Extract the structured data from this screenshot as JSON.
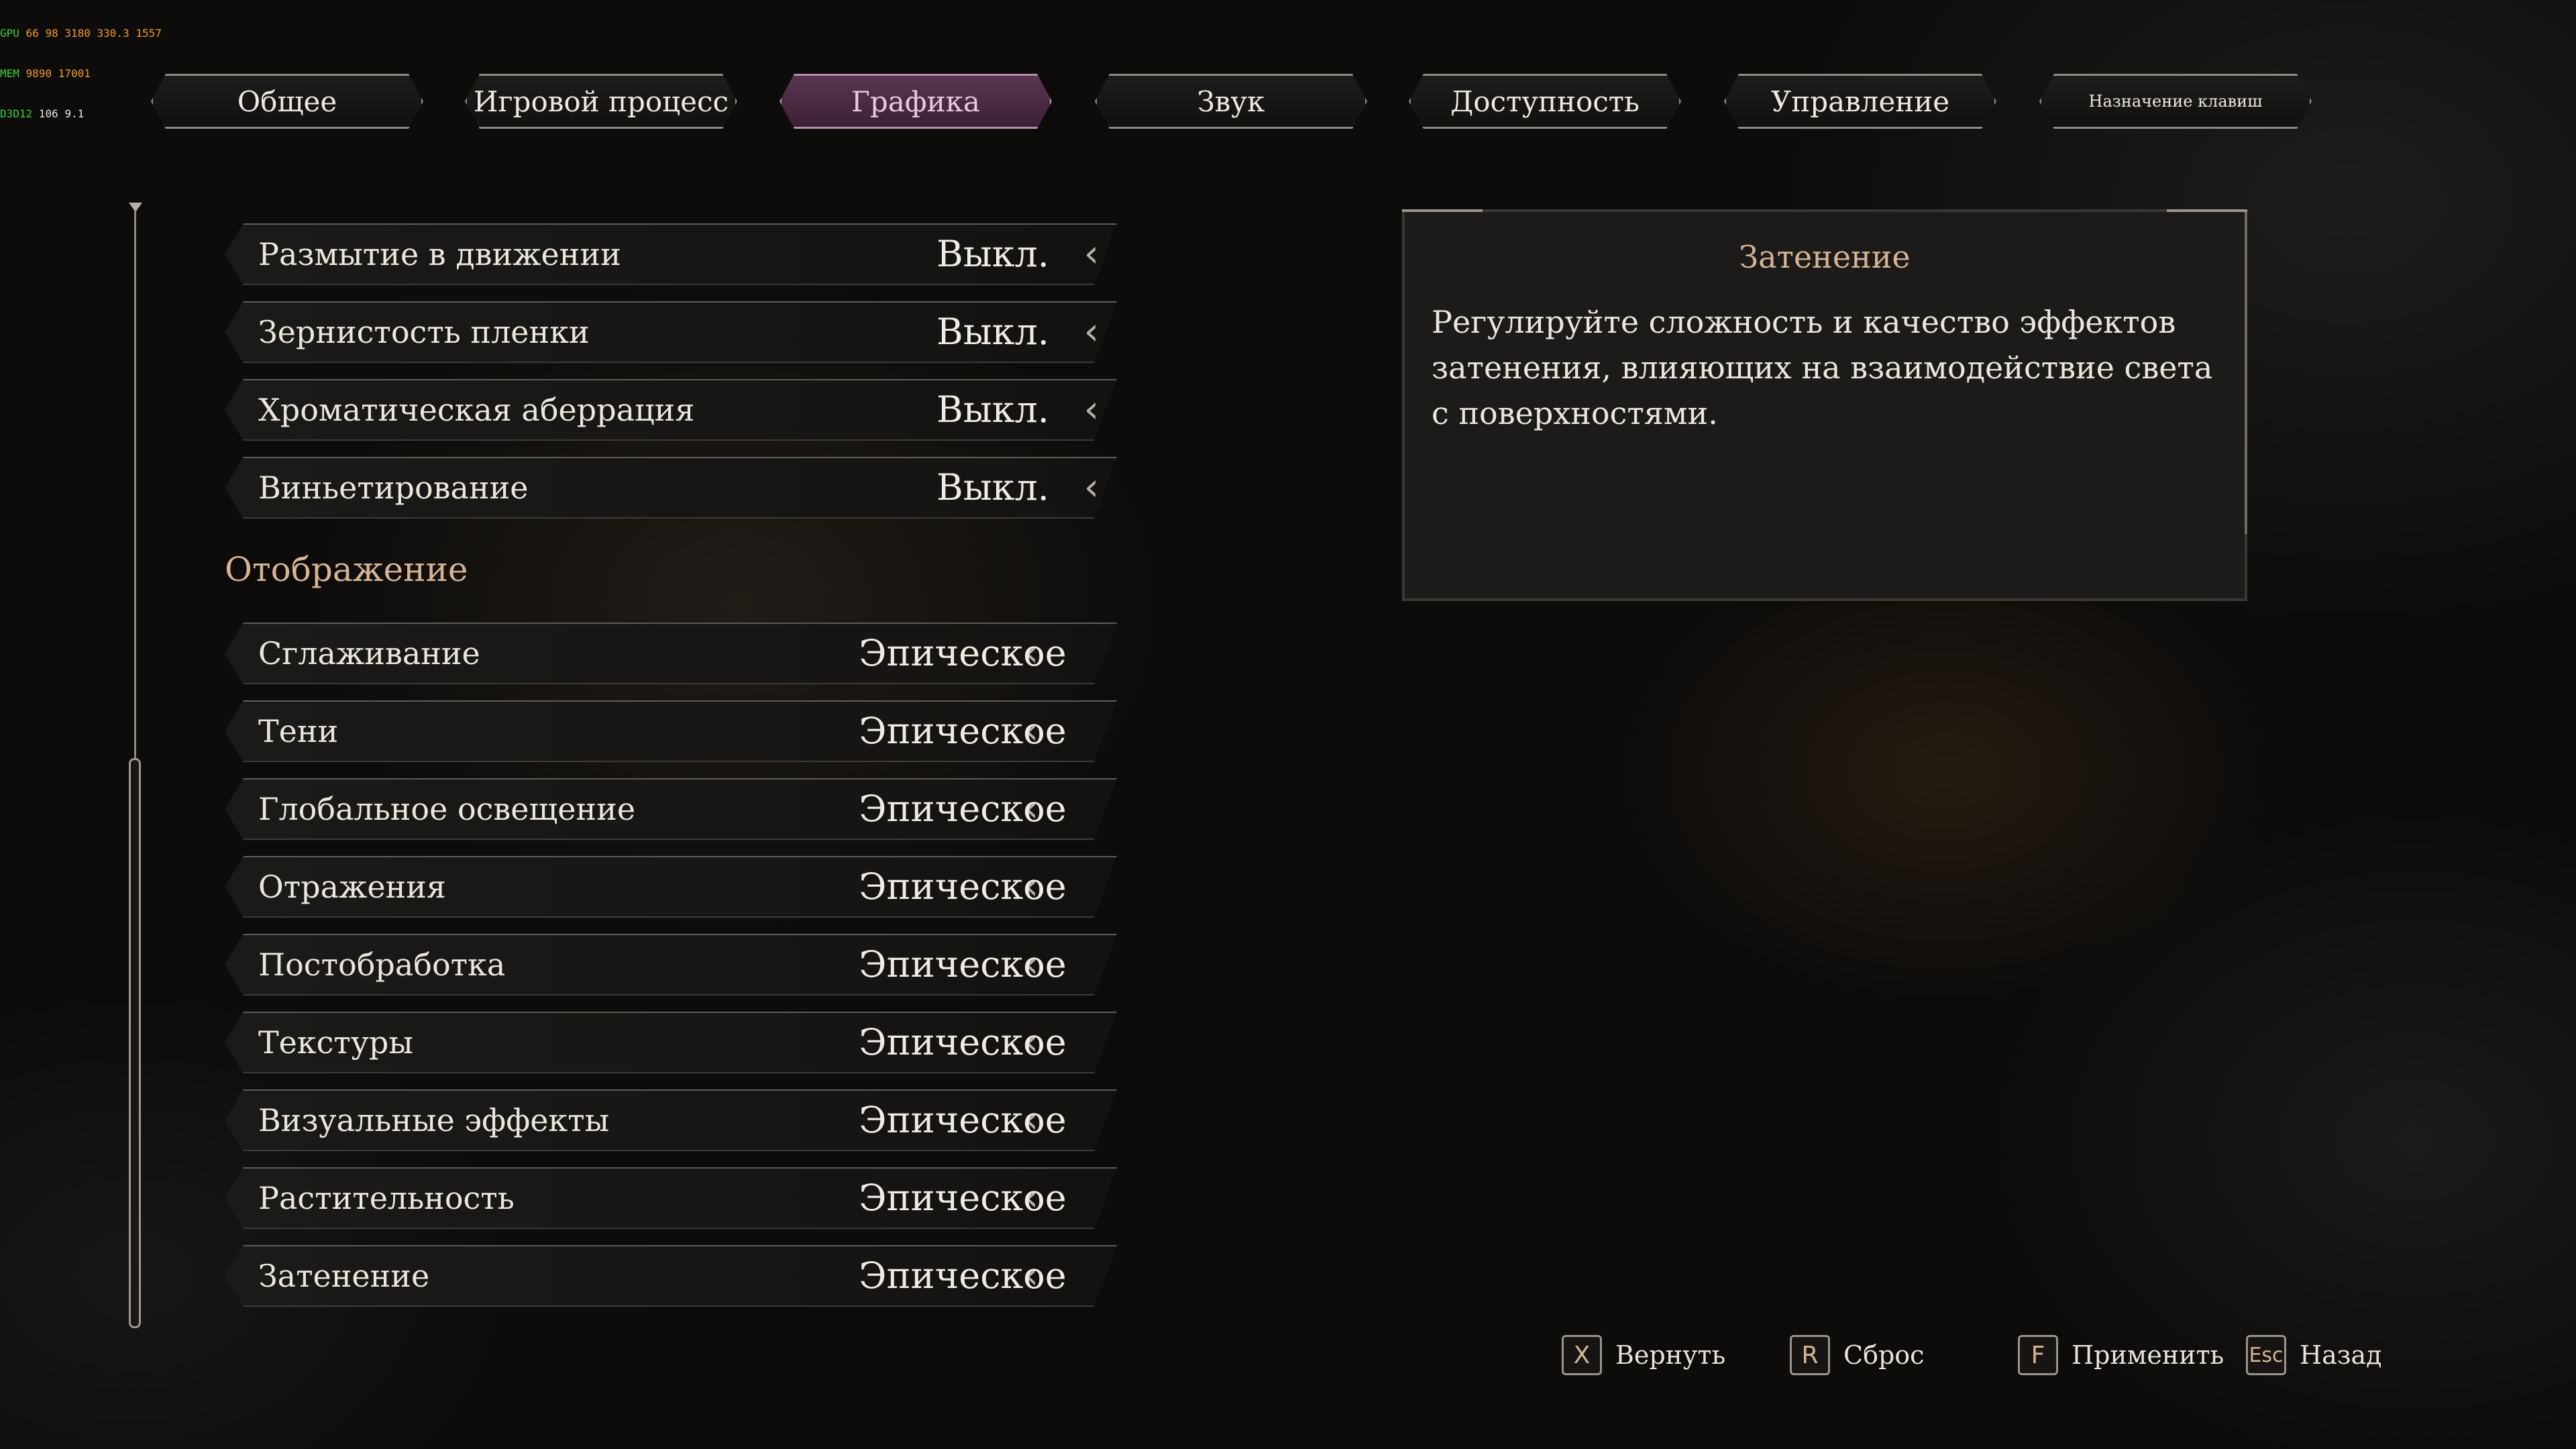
{
  "overlay": {
    "line1": [
      "GPU",
      "66",
      "98",
      "3180",
      "330.3",
      "1557"
    ],
    "line2": [
      "MEM",
      "9890",
      "17001"
    ],
    "line3": [
      "D3D12",
      "106",
      "9.1"
    ]
  },
  "tabs": [
    {
      "label": "Общее",
      "active": false
    },
    {
      "label": "Игровой процесс",
      "active": false
    },
    {
      "label": "Графика",
      "active": true
    },
    {
      "label": "Звук",
      "active": false
    },
    {
      "label": "Доступность",
      "active": false
    },
    {
      "label": "Управление",
      "active": false
    },
    {
      "label": "Назначение клавиш",
      "active": false
    }
  ],
  "effects_rows": [
    {
      "label": "Размытие в движении",
      "value": "Выкл."
    },
    {
      "label": "Зернистость пленки",
      "value": "Выкл."
    },
    {
      "label": "Хроматическая аберрация",
      "value": "Выкл."
    },
    {
      "label": "Виньетирование",
      "value": "Выкл."
    }
  ],
  "section_title": "Отображение",
  "display_rows": [
    {
      "label": "Сглаживание",
      "value": "Эпическое"
    },
    {
      "label": "Тени",
      "value": "Эпическое"
    },
    {
      "label": "Глобальное освещение",
      "value": "Эпическое"
    },
    {
      "label": "Отражения",
      "value": "Эпическое"
    },
    {
      "label": "Постобработка",
      "value": "Эпическое"
    },
    {
      "label": "Текстуры",
      "value": "Эпическое"
    },
    {
      "label": "Визуальные эффекты",
      "value": "Эпическое"
    },
    {
      "label": "Растительность",
      "value": "Эпическое"
    },
    {
      "label": "Затенение",
      "value": "Эпическое"
    }
  ],
  "description": {
    "title": "Затенение",
    "body": "Регулируйте сложность и качество эффектов затенения, влияющих на взаимодействие света с поверхностями."
  },
  "hints": [
    {
      "key": "X",
      "label": "Вернуть"
    },
    {
      "key": "R",
      "label": "Сброс"
    },
    {
      "key": "F",
      "label": "Применить"
    },
    {
      "key": "Esc",
      "label": "Назад"
    }
  ],
  "colors": {
    "accent_gold": "#d5b493",
    "active_tab": "#5a3550"
  }
}
